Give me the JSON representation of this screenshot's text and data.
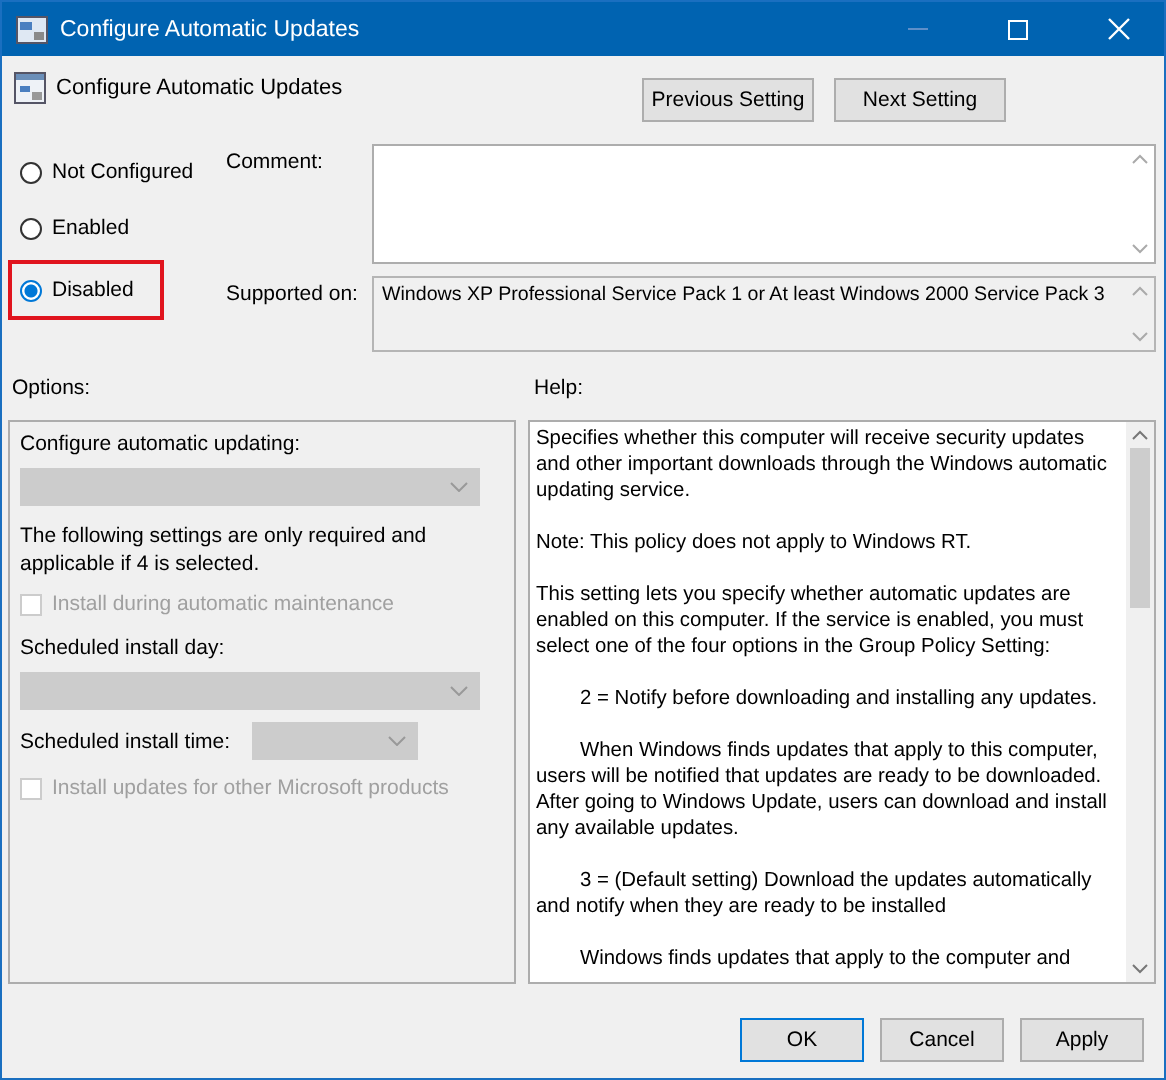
{
  "window": {
    "title": "Configure Automatic Updates"
  },
  "header": {
    "title": "Configure Automatic Updates",
    "buttons": [
      "Previous Setting",
      "Next Setting"
    ]
  },
  "states": [
    {
      "label": "Not Configured",
      "selected": false,
      "highlighted": false
    },
    {
      "label": "Enabled",
      "selected": false,
      "highlighted": false
    },
    {
      "label": "Disabled",
      "selected": true,
      "highlighted": true
    }
  ],
  "comment": {
    "label": "Comment:"
  },
  "supported_on": {
    "label": "Supported on:",
    "value": "Windows XP Professional Service Pack 1 or At least Windows 2000 Service Pack 3"
  },
  "options": {
    "label": "Options:",
    "items": [
      {
        "kind": "label",
        "text": "Configure automatic updating:"
      },
      {
        "kind": "dropdown",
        "disabled": true
      },
      {
        "kind": "note",
        "text": "The following settings are only required and applicable if 4 is selected."
      },
      {
        "kind": "checkbox",
        "text": "Install during automatic maintenance",
        "checked": false,
        "disabled": true
      },
      {
        "kind": "label",
        "text": "Scheduled install day:"
      },
      {
        "kind": "dropdown",
        "disabled": true
      },
      {
        "kind": "labeled-dropdown",
        "text": "Scheduled install time:",
        "disabled": true
      },
      {
        "kind": "checkbox",
        "text": "Install updates for other Microsoft products",
        "checked": false,
        "disabled": true
      }
    ]
  },
  "help": {
    "label": "Help:",
    "paragraphs": [
      {
        "text": "Specifies whether this computer will receive security updates and other important downloads through the Windows automatic updating service.",
        "indented": false
      },
      {
        "text": "Note: This policy does not apply to Windows RT.",
        "indented": false
      },
      {
        "text": "This setting lets you specify whether automatic updates are enabled on this computer. If the service is enabled, you must select one of the four options in the Group Policy Setting:",
        "indented": false
      },
      {
        "text": "2 = Notify before downloading and installing any updates.",
        "indented": true
      },
      {
        "text": "When Windows finds updates that apply to this computer, users will be notified that updates are ready to be downloaded. After going to Windows Update, users can download and install any available updates.",
        "indented": true
      },
      {
        "text": "3 = (Default setting) Download the updates automatically and notify when they are ready to be installed",
        "indented": true
      },
      {
        "text": "Windows finds updates that apply to the computer and",
        "indented": true
      }
    ]
  },
  "buttons": [
    {
      "label": "OK",
      "default": true
    },
    {
      "label": "Cancel",
      "default": false
    },
    {
      "label": "Apply",
      "default": false
    }
  ]
}
